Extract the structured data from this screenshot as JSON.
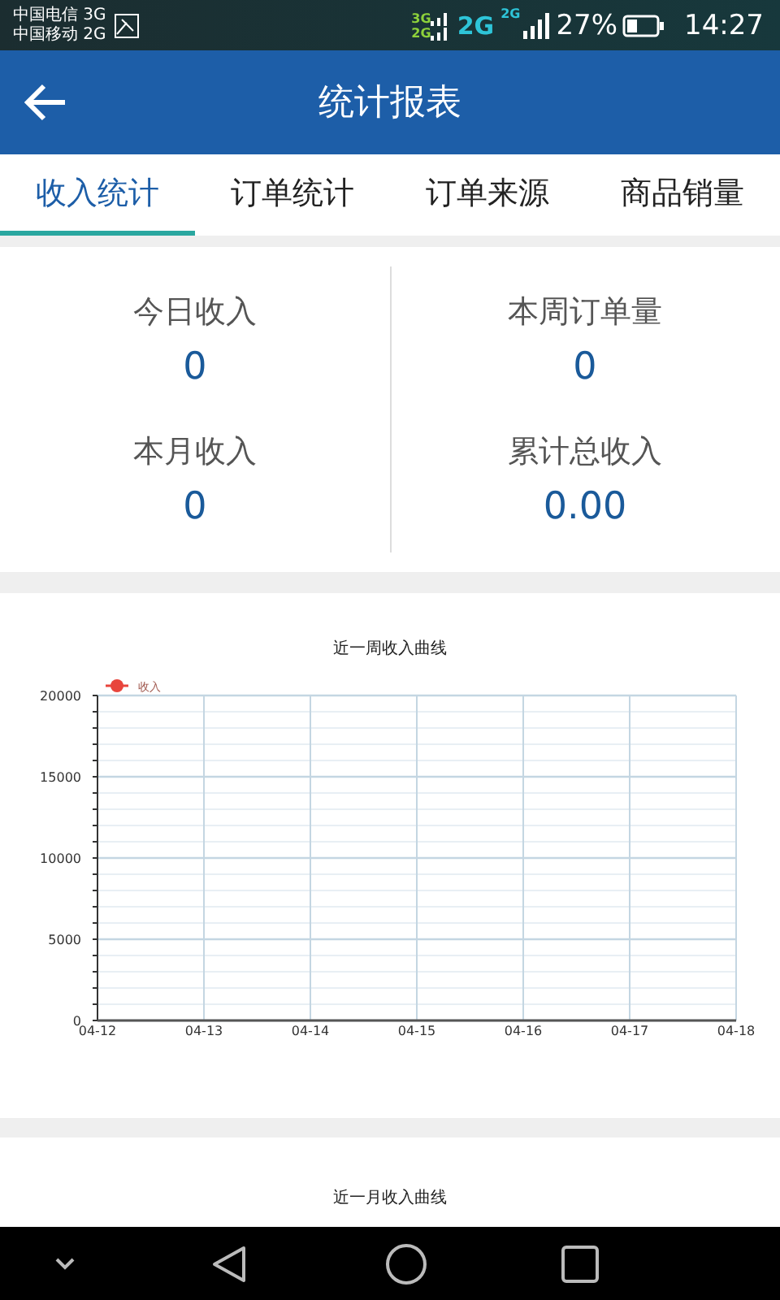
{
  "status_bar": {
    "carriers": [
      "中国电信 3G",
      "中国移动 2G"
    ],
    "network_labels": [
      "3G",
      "2G",
      "2G",
      "2G"
    ],
    "battery": "27%",
    "time": "14:27"
  },
  "app_bar": {
    "title": "统计报表"
  },
  "tabs": [
    {
      "label": "收入统计",
      "selected": true
    },
    {
      "label": "订单统计",
      "selected": false
    },
    {
      "label": "订单来源",
      "selected": false
    },
    {
      "label": "商品销量",
      "selected": false
    }
  ],
  "stats": [
    {
      "label": "今日收入",
      "value": "0"
    },
    {
      "label": "本周订单量",
      "value": "0"
    },
    {
      "label": "本月收入",
      "value": "0"
    },
    {
      "label": "累计总收入",
      "value": "0.00"
    }
  ],
  "charts": [
    {
      "chart_data": {
        "type": "line",
        "title": "近一周收入曲线",
        "categories": [
          "04-12",
          "04-13",
          "04-14",
          "04-15",
          "04-16",
          "04-17",
          "04-18"
        ],
        "ylim": [
          0,
          20000
        ],
        "grid": true,
        "yticks": [
          0,
          5000,
          10000,
          15000,
          20000
        ],
        "series": [
          {
            "name": "收入",
            "color": "#e8453c",
            "values": [
              null,
              null,
              null,
              null,
              null,
              null,
              null
            ]
          }
        ]
      }
    },
    {
      "title": "近一月收入曲线"
    }
  ]
}
